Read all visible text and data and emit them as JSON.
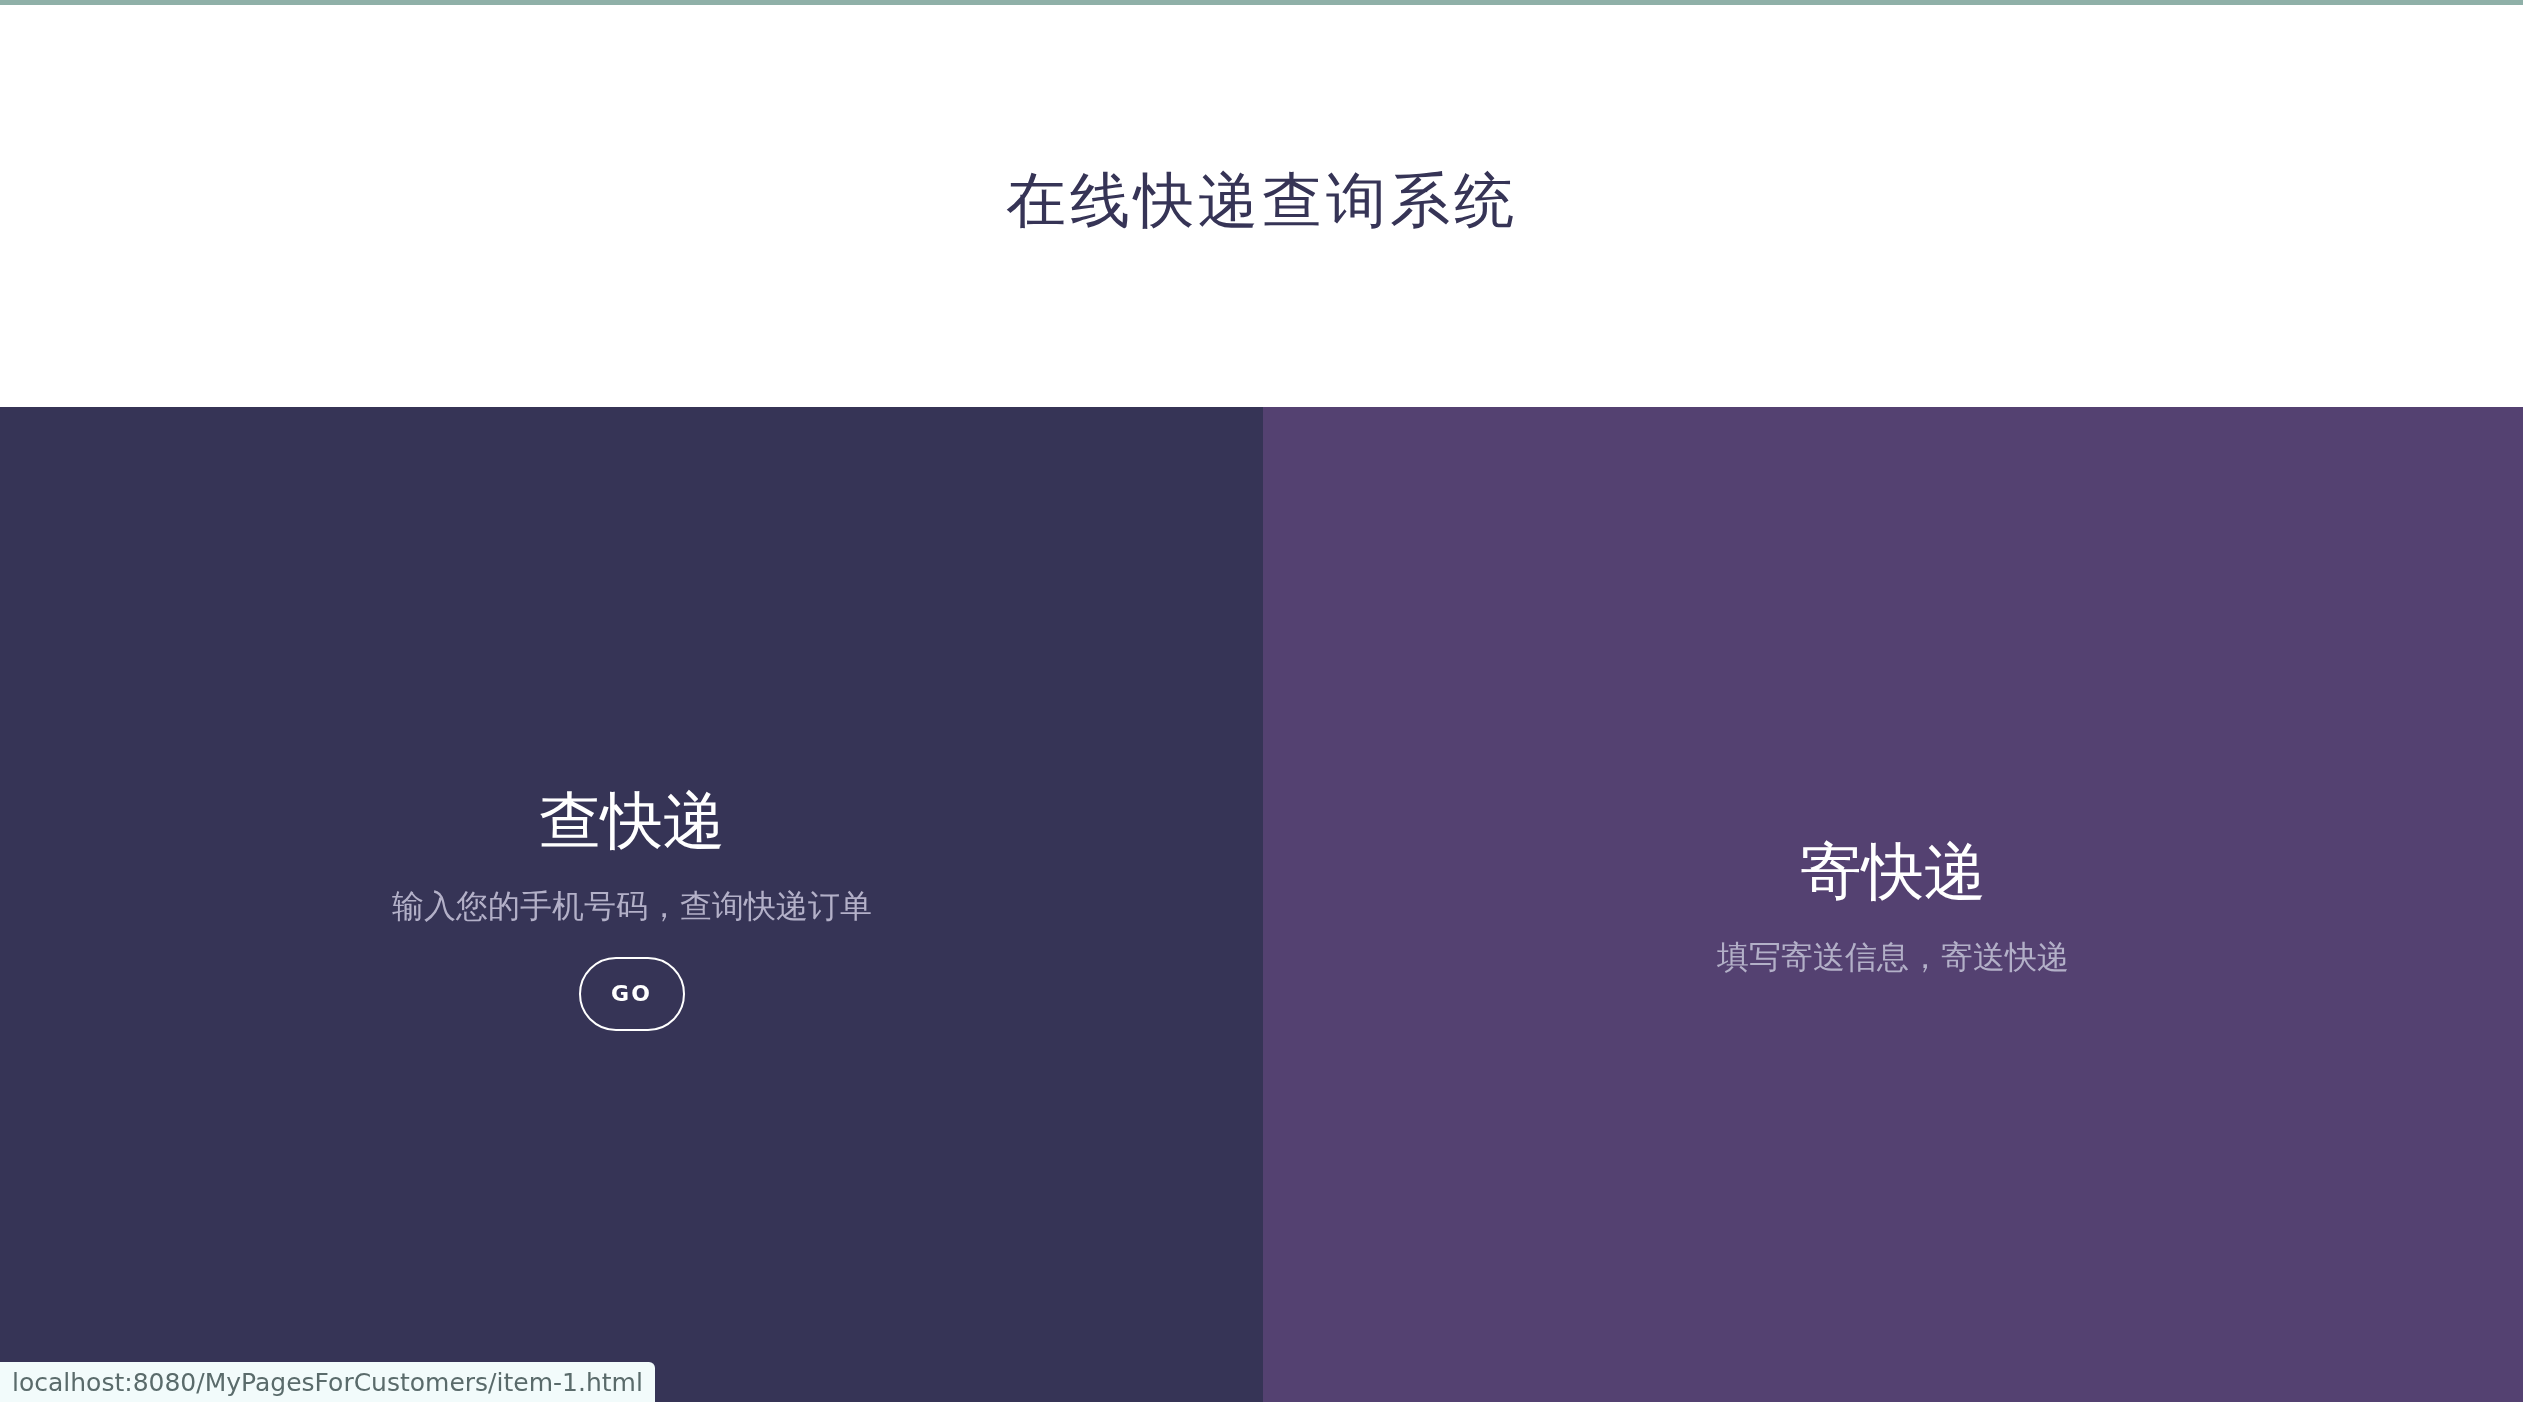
{
  "header": {
    "title": "在线快递查询系统"
  },
  "panels": [
    {
      "title": "查快递",
      "subtitle": "输入您的手机号码，查询快递订单",
      "button": "GO",
      "color": "#363456"
    },
    {
      "title": "寄快递",
      "subtitle": "填写寄送信息，寄送快递",
      "color": "#544171"
    }
  ],
  "status_bar": {
    "url": "localhost:8080/MyPagesForCustomers/item-1.html"
  }
}
